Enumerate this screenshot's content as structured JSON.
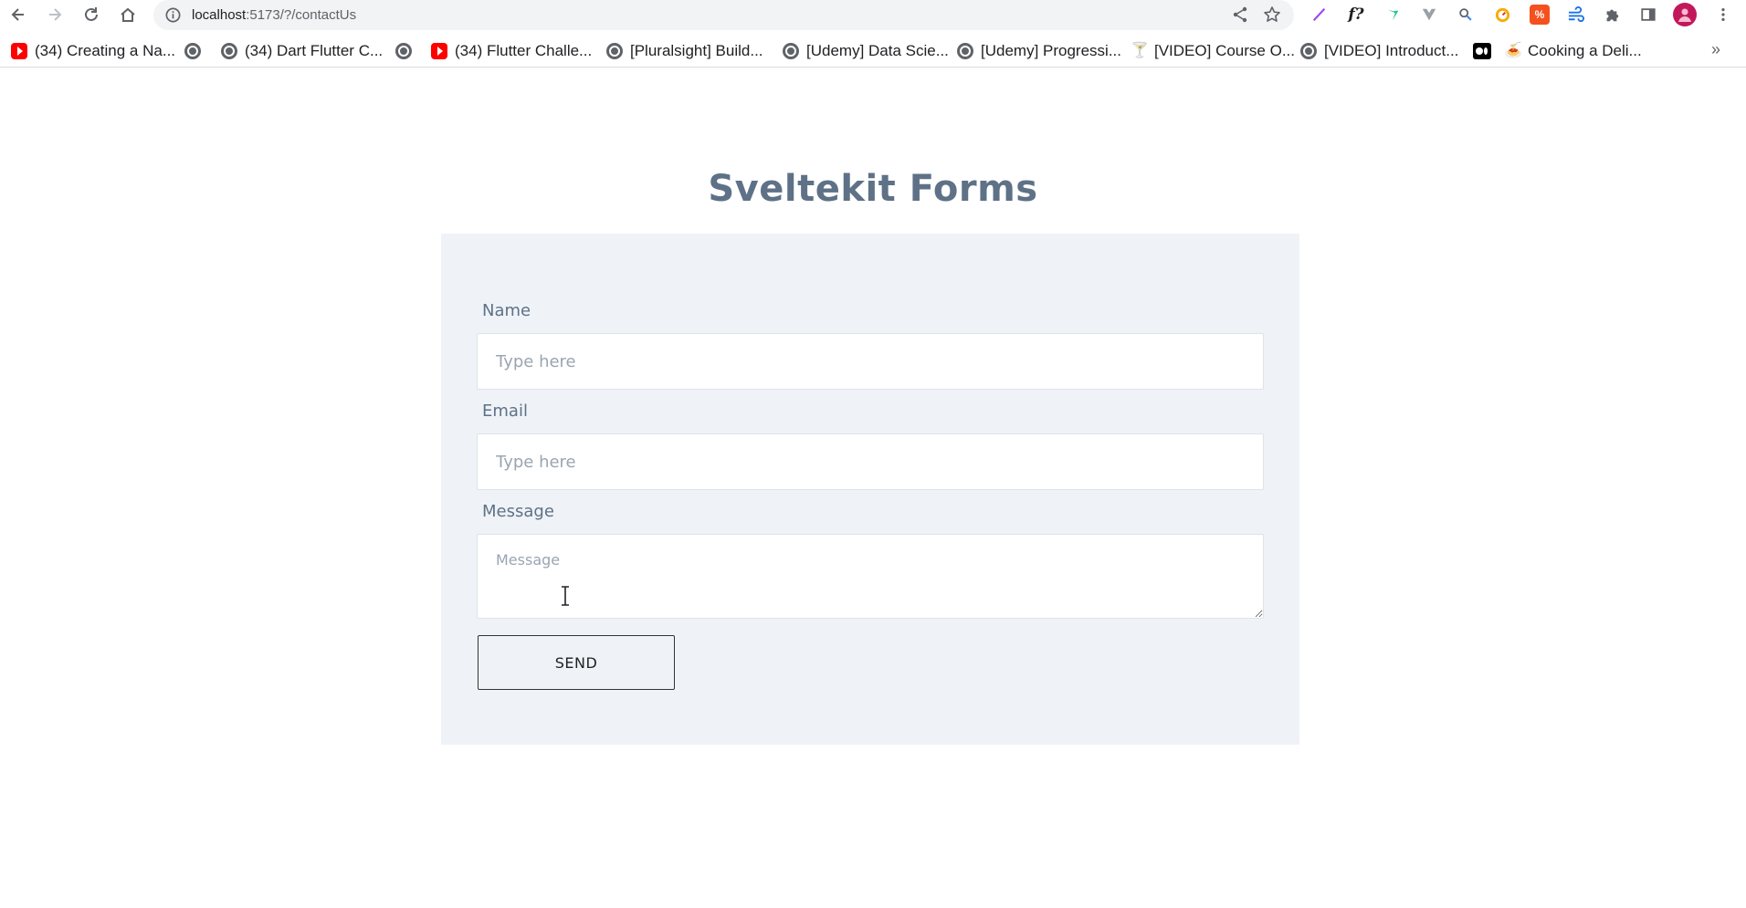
{
  "browser": {
    "url_host": "localhost",
    "url_path": ":5173/?/contactUs",
    "bookmarks": [
      {
        "label": "(34) Creating a Na...",
        "icon": "youtube-icon"
      },
      {
        "label": "",
        "icon": "globe-icon"
      },
      {
        "label": "(34) Dart Flutter C...",
        "icon": "globe-icon"
      },
      {
        "label": "",
        "icon": "globe-icon"
      },
      {
        "label": "(34) Flutter Challe...",
        "icon": "youtube-icon"
      },
      {
        "label": "[Pluralsight] Build...",
        "icon": "globe-icon"
      },
      {
        "label": "[Udemy] Data Scie...",
        "icon": "globe-icon"
      },
      {
        "label": "[Udemy] Progressi...",
        "icon": "globe-icon"
      },
      {
        "label": "[VIDEO] Course O...",
        "icon": "cocktail-icon"
      },
      {
        "label": "[VIDEO] Introduct...",
        "icon": "globe-icon"
      },
      {
        "label": "",
        "icon": "medium-icon"
      },
      {
        "label": "Cooking a Deli...",
        "icon": "food-icon"
      }
    ],
    "more_bookmarks": "»"
  },
  "page": {
    "title": "Sveltekit Forms",
    "form": {
      "name_label": "Name",
      "name_placeholder": "Type here",
      "email_label": "Email",
      "email_placeholder": "Type here",
      "message_label": "Message",
      "message_placeholder": "Message",
      "send_label": "SEND"
    }
  },
  "colors": {
    "title": "#5e7187",
    "card_background": "#eff3f7",
    "input_border": "#dde3ea"
  }
}
